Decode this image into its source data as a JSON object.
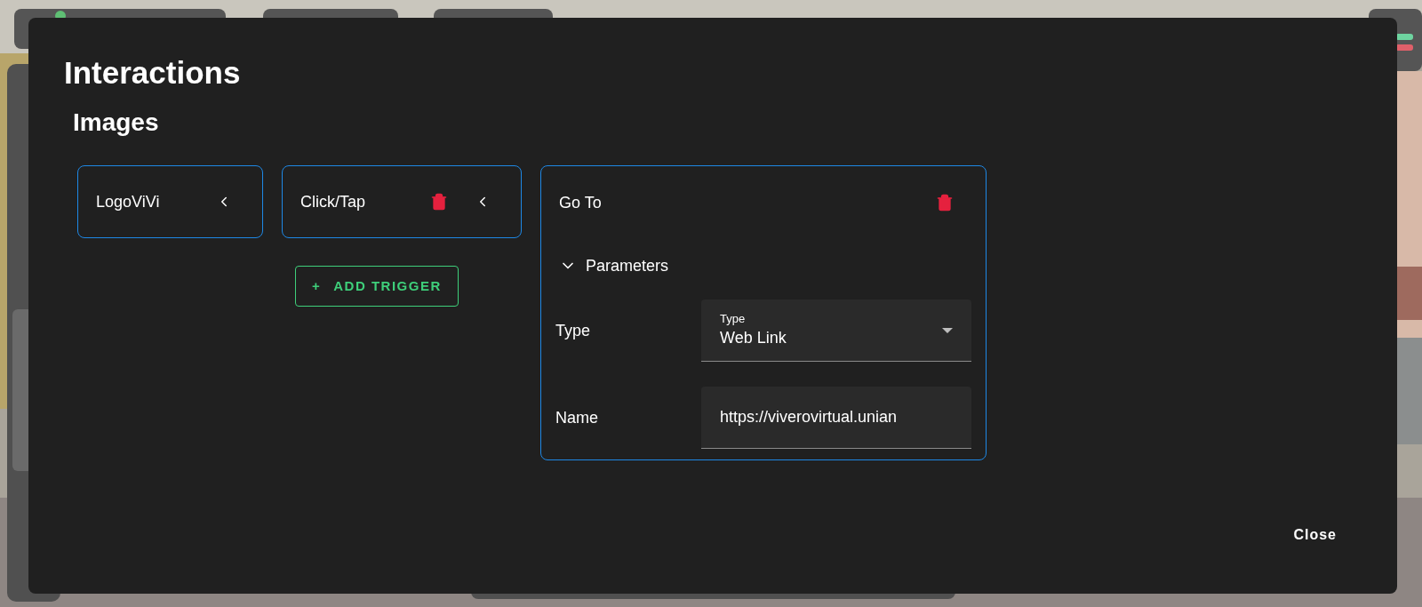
{
  "dialog": {
    "title": "Interactions",
    "section": "Images",
    "object_card": {
      "label": "LogoViVi"
    },
    "trigger_card": {
      "label": "Click/Tap"
    },
    "add_trigger_button": {
      "icon": "+",
      "label": "ADD TRIGGER"
    },
    "action_card": {
      "label": "Go To",
      "parameters": {
        "label": "Parameters",
        "expanded": true,
        "fields": [
          {
            "kind": "select",
            "label": "Type",
            "floating_label": "Type",
            "value": "Web Link"
          },
          {
            "kind": "text",
            "label": "Name",
            "value": "https://viverovirtual.unian"
          }
        ]
      }
    },
    "close_button": "Close"
  }
}
